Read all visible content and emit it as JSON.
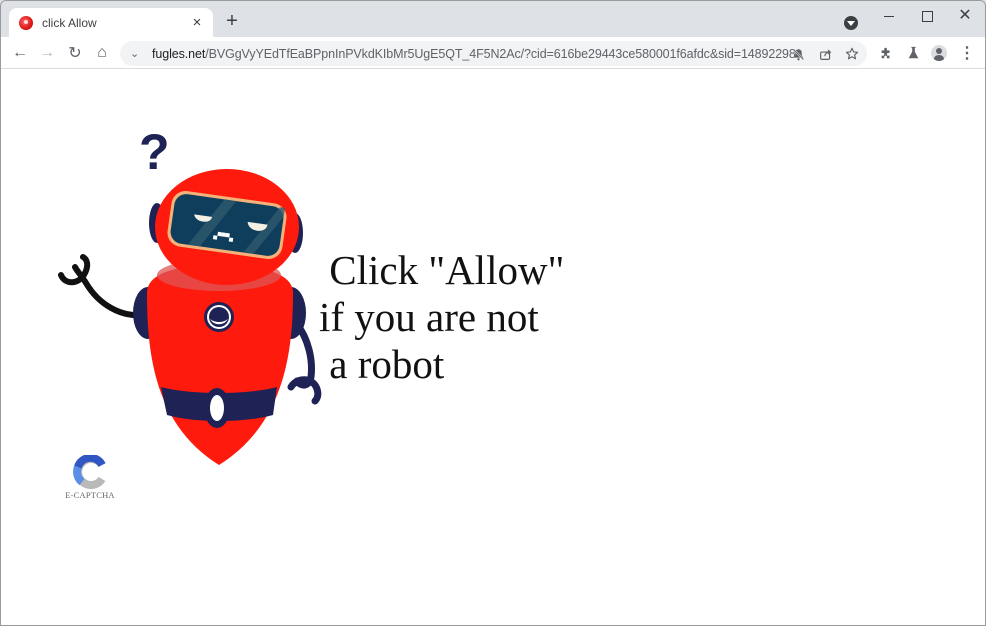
{
  "browser": {
    "tab": {
      "title": "click Allow",
      "favicon": "red-orb-icon",
      "close_label": "×"
    },
    "new_tab_label": "+",
    "window_controls": {
      "minimize": "minimize-icon",
      "maximize": "maximize-icon",
      "close_label": "✕"
    },
    "toolbar": {
      "back": "←",
      "forward": "→",
      "reload": "↻",
      "home": "⌂",
      "menu": "⋮"
    },
    "address_bar": {
      "chevron": "⌄",
      "host": "fugles.net",
      "path": "/BVGgVyYEdTfEaBPpnInPVkdKIbMr5UgE5QT_4F5N2Ac/?cid=616be29443ce580001f6afdc&sid=14892298"
    },
    "omnibox_icons": [
      "notifications-blocked-icon",
      "share-icon",
      "bookmark-star-icon"
    ],
    "toolbar_icons": [
      "extensions-icon",
      "labs-flask-icon",
      "profile-avatar-icon",
      "kebab-menu-icon"
    ]
  },
  "page": {
    "message_lines": [
      "Click \"Allow\"",
      "if you are not",
      "a robot"
    ],
    "captcha_label": "E-CAPTCHA",
    "question_mark": "?",
    "colors": {
      "robot_red": "#ff1a0e",
      "robot_navy": "#1f2255",
      "visor": "#0f3d5c",
      "visor_rim": "#f3b27a",
      "captcha_blue": "#3d6fd6",
      "captcha_grey": "#b9b9b9"
    }
  }
}
